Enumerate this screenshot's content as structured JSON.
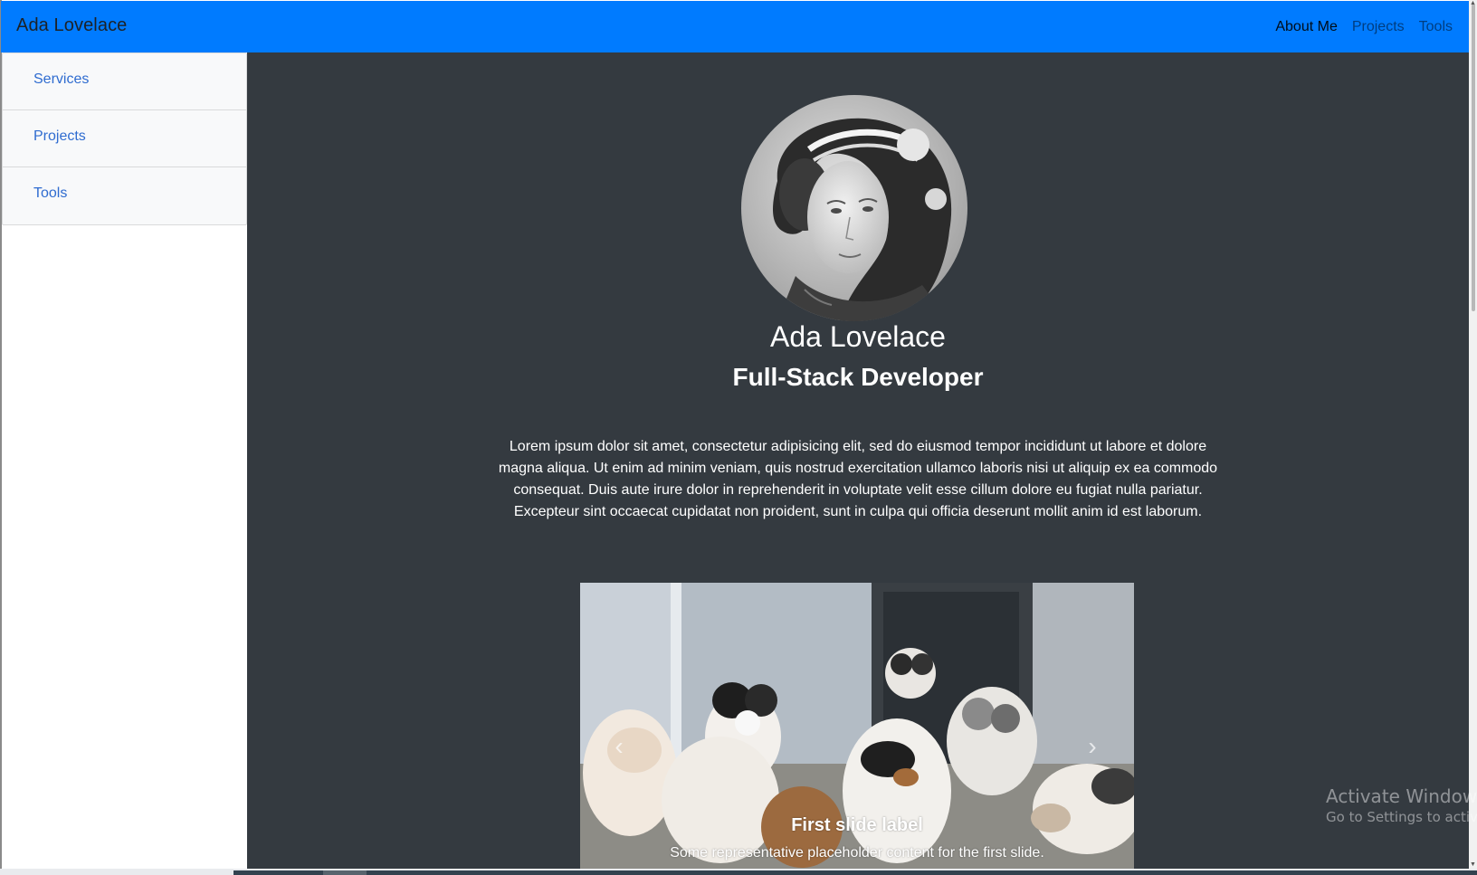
{
  "navbar": {
    "brand": "Ada Lovelace",
    "links": [
      {
        "label": "About Me",
        "active": true
      },
      {
        "label": "Projects",
        "active": false
      },
      {
        "label": "Tools",
        "active": false
      }
    ],
    "color": "#007bff"
  },
  "sidebar": {
    "items": [
      {
        "label": "Services"
      },
      {
        "label": "Projects"
      },
      {
        "label": "Tools"
      }
    ]
  },
  "profile": {
    "name": "Ada Lovelace",
    "role": "Full-Stack Developer",
    "bio": "Lorem ipsum dolor sit amet, consectetur adipisicing elit, sed do eiusmod tempor incididunt ut labore et dolore magna aliqua. Ut enim ad minim veniam, quis nostrud exercitation ullamco laboris nisi ut aliquip ex ea commodo consequat. Duis aute irure dolor in reprehenderit in voluptate velit esse cillum dolore eu fugiat nulla pariatur. Excepteur sint occaecat cupidatat non proident, sunt in culpa qui officia deserunt mollit anim id est laborum."
  },
  "carousel": {
    "slide": {
      "title": "First slide label",
      "text": "Some representative placeholder content for the first slide."
    },
    "prev_icon": "chevron-left-icon",
    "next_icon": "chevron-right-icon"
  },
  "watermark": {
    "title": "Activate Windows",
    "subtitle": "Go to Settings to activate"
  },
  "colors": {
    "main_bg": "#343a40",
    "link": "#2f6cd0"
  }
}
